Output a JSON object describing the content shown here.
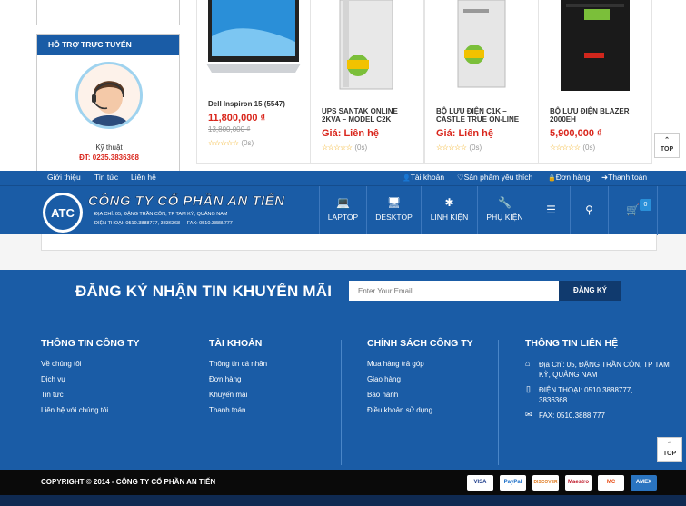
{
  "support": {
    "title": "HỖ TRỢ TRỰC TUYẾN",
    "name": "Kỹ thuật",
    "phone": "ĐT: 0235.3836368"
  },
  "products": [
    {
      "name": "Dell Inspiron 15 (5547)",
      "price": "11,800,000 ₫",
      "old_price": "13,800,000 ₫",
      "rating": "(0s)"
    },
    {
      "name": "UPS SANTAK ONLINE 2KVA – MODEL C2K",
      "price": "Giá: Liên hệ",
      "rating": "(0s)"
    },
    {
      "name": "BỘ LƯU ĐIỆN C1K – CASTLE TRUE ON-LINE",
      "price": "Giá: Liên hệ",
      "rating": "(0s)"
    },
    {
      "name": "BỘ LƯU ĐIỆN BLAZER 2000EH",
      "price": "5,900,000 ₫",
      "rating": "(0s)"
    }
  ],
  "stars": "☆☆☆☆☆",
  "top_label": "TOP",
  "navbar": {
    "left": [
      "Giới thiệu",
      "Tin tức",
      "Liên hệ"
    ],
    "right": [
      {
        "icon": "user-icon",
        "glyph": "👤",
        "label": "Tài khoản"
      },
      {
        "icon": "heart-icon",
        "glyph": "♡",
        "label": "Sản phẩm yêu thích"
      },
      {
        "icon": "lock-icon",
        "glyph": "🔒",
        "label": "Đơn hàng"
      },
      {
        "icon": "signin-icon",
        "glyph": "➜",
        "label": "Thanh toán"
      }
    ]
  },
  "logo": {
    "abbr": "ATC",
    "name": "CÔNG TY CỔ PHẦN AN TIẾN",
    "address": "ĐỊA CHỈ: 05, ĐẶNG TRẦN CÔN, TP TAM KỲ, QUẢNG NAM",
    "contact": "ĐIỆN THOẠI: 0510.3888777, 3836368     FAX: 0510.3888.777"
  },
  "menu": [
    {
      "icon": "laptop-icon",
      "glyph": "💻",
      "label": "LAPTOP"
    },
    {
      "icon": "desktop-icon",
      "glyph": "🖥",
      "label": "DESKTOP"
    },
    {
      "icon": "paw-icon",
      "glyph": "✱",
      "label": "LINH KIỆN"
    },
    {
      "icon": "wrench-icon",
      "glyph": "🔧",
      "label": "PHỤ KIỆN"
    }
  ],
  "cart_count": "0",
  "newsletter": {
    "title": "ĐĂNG KÝ NHẬN TIN KHUYẾN MÃI",
    "placeholder": "Enter Your Email...",
    "button": "ĐĂNG KÝ"
  },
  "footer": {
    "company": {
      "title": "THÔNG TIN CÔNG TY",
      "links": [
        "Về chúng tôi",
        "Dịch vụ",
        "Tin tức",
        "Liên hệ với chúng tôi"
      ]
    },
    "account": {
      "title": "TÀI KHOẢN",
      "links": [
        "Thông tin cá nhân",
        "Đơn hàng",
        "Khuyến mãi",
        "Thanh toán"
      ]
    },
    "policy": {
      "title": "CHÍNH SÁCH CÔNG TY",
      "links": [
        "Mua hàng trả góp",
        "Giao hàng",
        "Bảo hành",
        "Điều khoản sử dụng"
      ]
    },
    "contact": {
      "title": "THÔNG TIN LIÊN HỆ",
      "address": "Địa Chỉ: 05, ĐẶNG TRẦN CÔN, TP TAM KỲ, QUẢNG NAM",
      "phone": "ĐIỆN THOẠI: 0510.3888777, 3836368",
      "fax": "FAX: 0510.3888.777"
    }
  },
  "copyright": "COPYRIGHT © 2014 - CÔNG TY CỔ PHẦN AN TIẾN",
  "payments": [
    {
      "name": "visa-icon",
      "label": "VISA",
      "color": "#1a3a8a"
    },
    {
      "name": "paypal-icon",
      "label": "PayPal",
      "color": "#1a6ec8"
    },
    {
      "name": "discover-icon",
      "label": "DISCOVER",
      "color": "#e07b20"
    },
    {
      "name": "maestro-icon",
      "label": "Maestro",
      "color": "#c01c2c"
    },
    {
      "name": "mastercard-icon",
      "label": "MC",
      "color": "#e8501a"
    },
    {
      "name": "amex-icon",
      "label": "AMEX",
      "color": "#2a74c0"
    }
  ]
}
